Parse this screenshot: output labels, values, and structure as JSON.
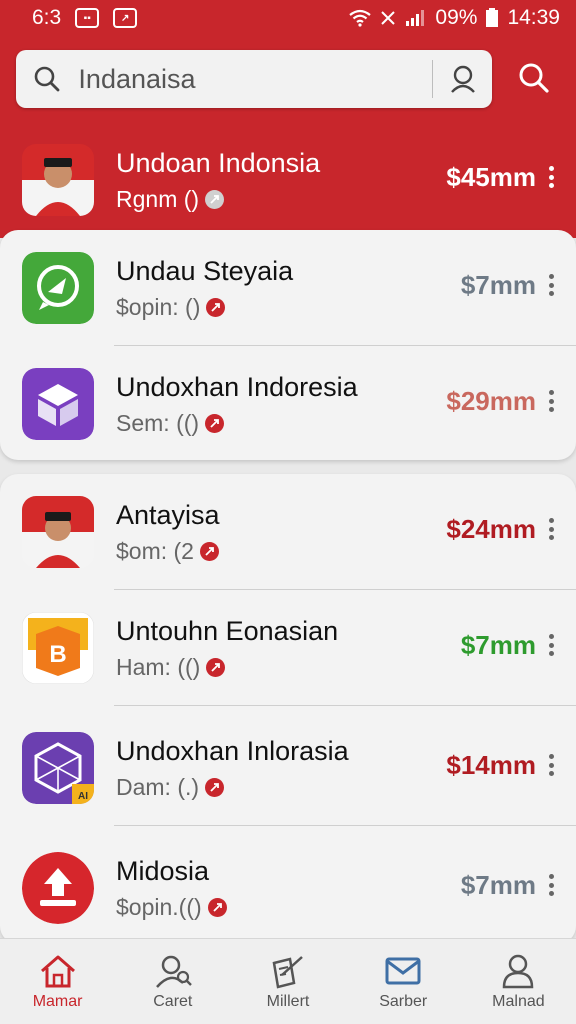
{
  "status_bar": {
    "time_left": "6:3",
    "battery": "09%",
    "clock": "14:39"
  },
  "search": {
    "query": "Indanaisa"
  },
  "colors": {
    "brand_red": "#c8262c",
    "price_red": "#b01c22",
    "price_grey": "#6e7a86",
    "price_green": "#2e9b2e",
    "price_salmon": "#c9685e"
  },
  "list": [
    {
      "title": "Undoan Indonsia",
      "subtitle": "Rgnm ()",
      "price": "$45mm",
      "icon": "flag-portrait-icon",
      "highlight": true
    },
    {
      "title": "Undau Steyaia",
      "subtitle": "$opin: ()",
      "price": "$7mm",
      "icon": "chat-bubble-icon",
      "price_color": "#6e7a86"
    },
    {
      "title": "Undoxhan Indoresia",
      "subtitle": "Sem: (()",
      "price": "$29mm",
      "icon": "cube-icon",
      "price_color": "#c9685e"
    },
    {
      "title": "Antayisa",
      "subtitle": "$om: (2",
      "price": "$24mm",
      "icon": "flag-portrait-icon",
      "price_color": "#b01c22"
    },
    {
      "title": "Untouhn Eonasian",
      "subtitle": "Ham: (()",
      "price": "$7mm",
      "icon": "b-box-icon",
      "price_color": "#2e9b2e"
    },
    {
      "title": "Undoxhan Inlorasia",
      "subtitle": "Dam: (.)",
      "price": "$14mm",
      "icon": "crystal-box-icon",
      "price_color": "#b01c22"
    },
    {
      "title": "Midosia",
      "subtitle": "$opin.(()",
      "price": "$7mm",
      "icon": "upload-circle-icon",
      "price_color": "#6e7a86"
    }
  ],
  "bottom_nav": [
    {
      "label": "Mamar",
      "icon": "home-icon",
      "active": true
    },
    {
      "label": "Caret",
      "icon": "person-search-icon"
    },
    {
      "label": "Millert",
      "icon": "edit-note-icon"
    },
    {
      "label": "Sarber",
      "icon": "mail-icon"
    },
    {
      "label": "Malnad",
      "icon": "user-icon"
    }
  ]
}
